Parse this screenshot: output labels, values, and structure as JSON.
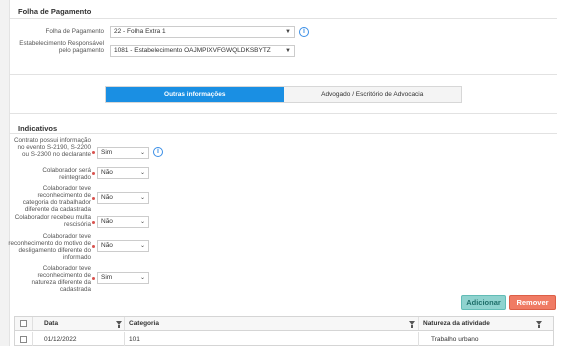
{
  "folha_section": {
    "title": "Folha de Pagamento",
    "folha_label": "Folha de Pagamento",
    "folha_value": "22 - Folha Extra 1",
    "estab_label": "Estabelecimento Responsável pelo pagamento",
    "estab_value": "1081 - Estabelecimento OAJMPIXVFGWQLDKSBYTZ"
  },
  "tabs": [
    {
      "label": "Outras informações",
      "active": true
    },
    {
      "label": "Advogado / Escritório de Advocacia",
      "active": false
    }
  ],
  "indicativos": {
    "title": "Indicativos",
    "fields": [
      {
        "label": "Contrato possui informação no evento S-2190, S-2200 ou S-2300 no declarante",
        "value": "Sim"
      },
      {
        "label": "Colaborador será reintegrado",
        "value": "Não"
      },
      {
        "label": "Colaborador teve reconhecimento de categoria do trabalhador diferente da cadastrada",
        "value": "Não"
      },
      {
        "label": "Colaborador recebeu multa rescisória",
        "value": "Não"
      },
      {
        "label": "Colaborador teve reconhecimento do motivo de desligamento diferente do informado",
        "value": "Não"
      },
      {
        "label": "Colaborador teve reconhecimento de natureza diferente da cadastrada",
        "value": "Sim"
      }
    ]
  },
  "actions": {
    "add_label": "Adicionar",
    "remove_label": "Remover"
  },
  "table": {
    "columns": [
      "Data",
      "Categoria",
      "Natureza da atividade"
    ],
    "rows": [
      [
        "01/12/2022",
        "101",
        "Trabalho urbano"
      ]
    ]
  },
  "colors": {
    "accent": "#1a8fe3",
    "add": "#8fd3cf",
    "remove": "#f07b64",
    "required": "#d9534f"
  }
}
